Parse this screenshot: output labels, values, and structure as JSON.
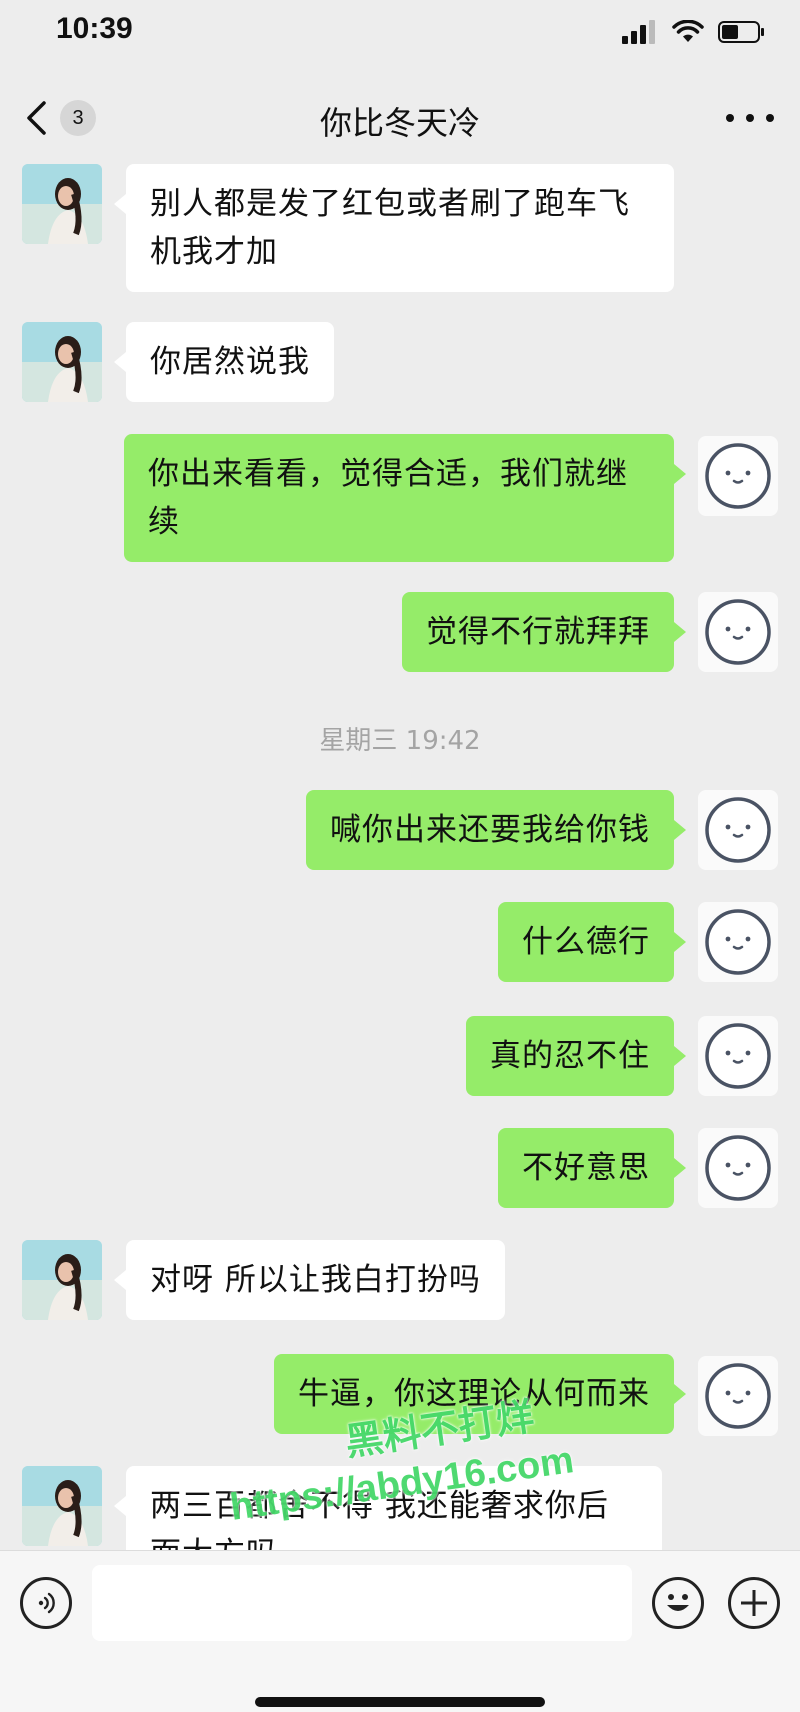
{
  "status_bar": {
    "time": "10:39",
    "icons": [
      "cellular-signal-icon",
      "wifi-icon",
      "battery-icon"
    ]
  },
  "nav": {
    "back_icon": "chevron-left-icon",
    "unread_count": "3",
    "title": "你比冬天冷",
    "more_icon": "more-dots-icon"
  },
  "messages": [
    {
      "side": "in",
      "text": "别人都是发了红包或者刷了跑车飞机我才加"
    },
    {
      "side": "in",
      "text": "你居然说我"
    },
    {
      "side": "out",
      "text": "你出来看看，觉得合适，我们就继续"
    },
    {
      "side": "out",
      "text": "觉得不行就拜拜"
    },
    {
      "side": "out",
      "text": "喊你出来还要我给你钱"
    },
    {
      "side": "out",
      "text": "什么德行"
    },
    {
      "side": "out",
      "text": "真的忍不住"
    },
    {
      "side": "out",
      "text": "不好意思"
    },
    {
      "side": "in",
      "text": "对呀  所以让我白打扮吗"
    },
    {
      "side": "out",
      "text": "牛逼，你这理论从何而来"
    },
    {
      "side": "in",
      "text": "两三百都舍不得  我还能奢求你后面大方吗"
    }
  ],
  "timestamp": "星期三 19:42",
  "watermark": {
    "line1": "黑料不打烊",
    "line2": "https://abdy16.com"
  },
  "input_bar": {
    "voice_icon": "voice-icon",
    "emoji_icon": "emoji-icon",
    "plus_icon": "plus-icon"
  },
  "colors": {
    "background": "#ededed",
    "outgoing_bubble": "#95ec69",
    "incoming_bubble": "#ffffff",
    "watermark": "#46d86a"
  }
}
